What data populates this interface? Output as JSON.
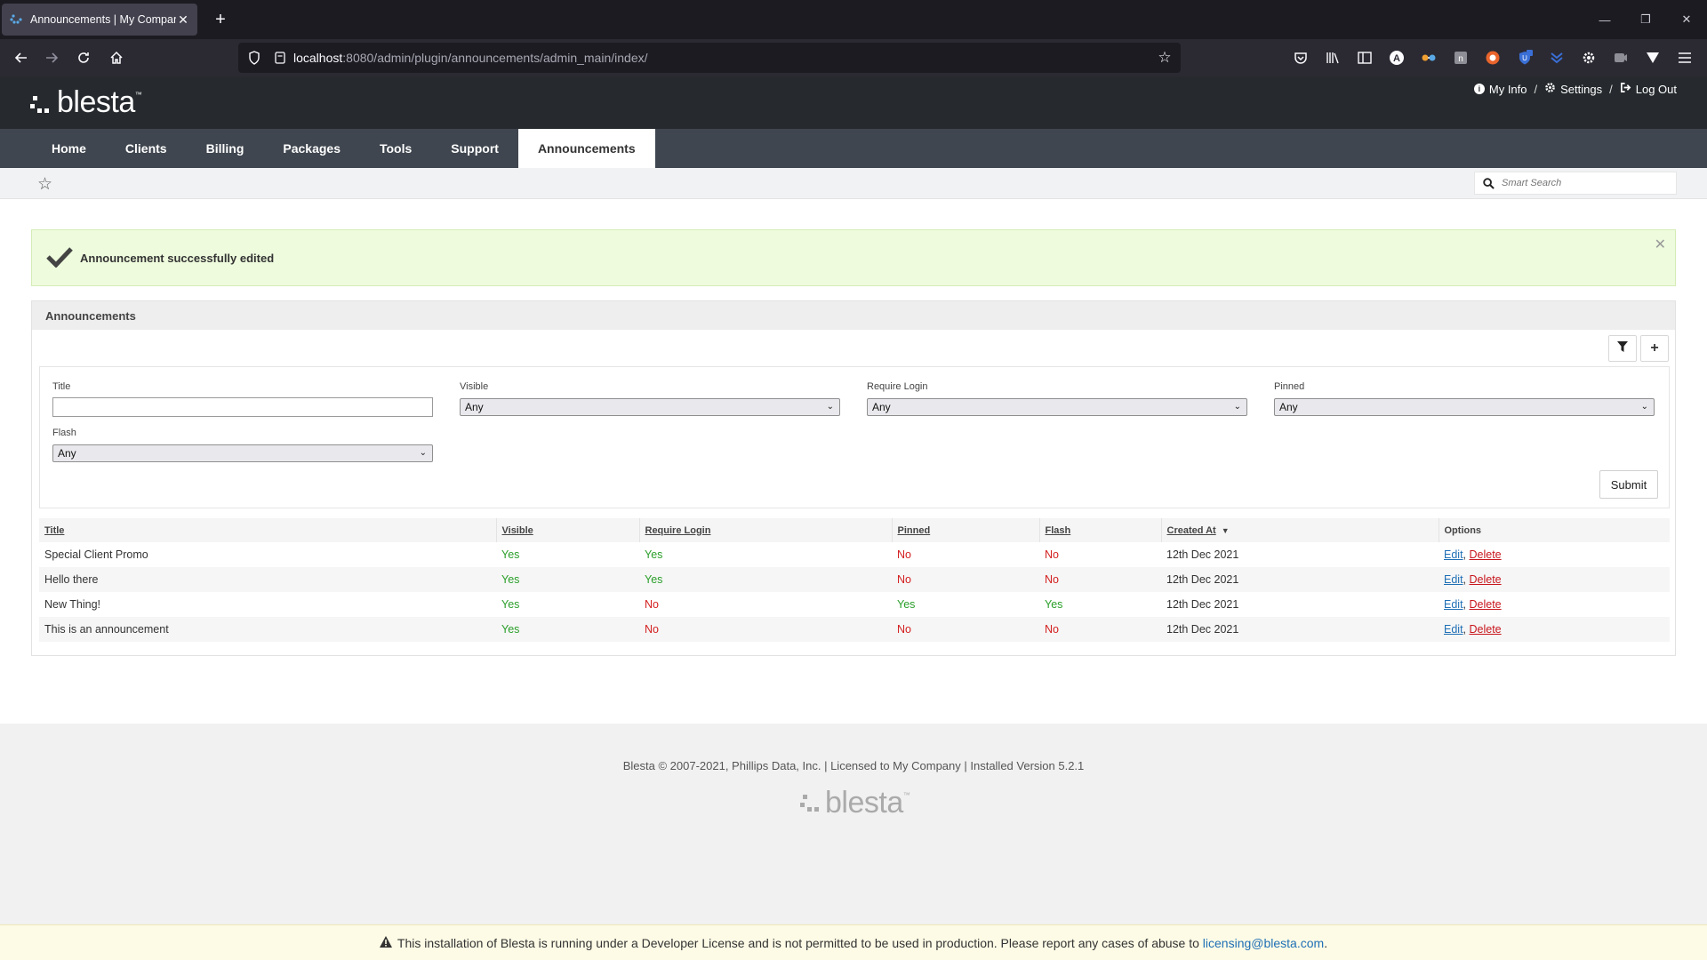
{
  "browser": {
    "tab_title": "Announcements | My Company",
    "url_host": "localhost",
    "url_path": ":8080/admin/plugin/announcements/admin_main/index/"
  },
  "header": {
    "logo_text": "blesta",
    "logo_tm": "™",
    "links": {
      "my_info": "My Info",
      "settings": "Settings",
      "log_out": "Log Out"
    },
    "sep": "/"
  },
  "nav": {
    "items": [
      {
        "label": "Home"
      },
      {
        "label": "Clients"
      },
      {
        "label": "Billing"
      },
      {
        "label": "Packages"
      },
      {
        "label": "Tools"
      },
      {
        "label": "Support"
      },
      {
        "label": "Announcements"
      }
    ]
  },
  "search": {
    "placeholder": "Smart Search"
  },
  "alert": {
    "message": "Announcement successfully edited"
  },
  "panel": {
    "title": "Announcements"
  },
  "filters": {
    "title_label": "Title",
    "title_value": "",
    "visible_label": "Visible",
    "visible_value": "Any",
    "require_login_label": "Require Login",
    "require_login_value": "Any",
    "pinned_label": "Pinned",
    "pinned_value": "Any",
    "flash_label": "Flash",
    "flash_value": "Any",
    "submit_label": "Submit"
  },
  "table": {
    "headers": [
      "Title",
      "Visible",
      "Require Login",
      "Pinned",
      "Flash",
      "Created At",
      "Options"
    ],
    "rows": [
      {
        "title": "Special Client Promo",
        "visible": "Yes",
        "require_login": "Yes",
        "pinned": "No",
        "flash": "No",
        "created": "12th Dec 2021",
        "edit": "Edit",
        "delete": "Delete"
      },
      {
        "title": "Hello there",
        "visible": "Yes",
        "require_login": "Yes",
        "pinned": "No",
        "flash": "No",
        "created": "12th Dec 2021",
        "edit": "Edit",
        "delete": "Delete"
      },
      {
        "title": "New Thing!",
        "visible": "Yes",
        "require_login": "No",
        "pinned": "Yes",
        "flash": "Yes",
        "created": "12th Dec 2021",
        "edit": "Edit",
        "delete": "Delete"
      },
      {
        "title": "This is an announcement",
        "visible": "Yes",
        "require_login": "No",
        "pinned": "No",
        "flash": "No",
        "created": "12th Dec 2021",
        "edit": "Edit",
        "delete": "Delete"
      }
    ]
  },
  "footer": {
    "text": "Blesta © 2007-2021, Phillips Data, Inc. | Licensed to My Company | Installed Version 5.2.1",
    "logo_text": "blesta",
    "logo_tm": "™"
  },
  "devbar": {
    "text": "This installation of Blesta is running under a Developer License and is not permitted to be used in production. Please report any cases of abuse to",
    "email": "licensing@blesta.com",
    "end": "."
  },
  "colors": {
    "yes": "#2a9f2a",
    "no": "#d42020",
    "header_bg": "#262a2e",
    "nav_bg": "#3f464f",
    "alert_bg": "#eefbdd"
  }
}
